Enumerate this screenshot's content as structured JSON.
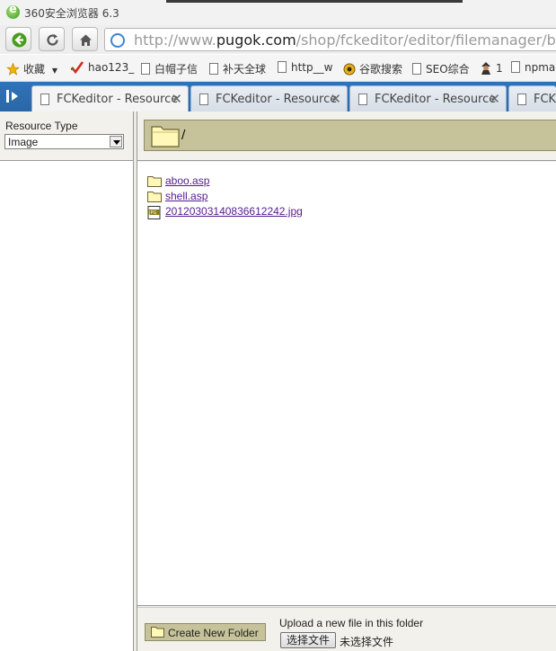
{
  "browser": {
    "title": "360安全浏览器 6.3",
    "url_prefix": "http://www.",
    "url_host": "pugok.com",
    "url_path": "/shop/fckeditor/editor/filemanager/brov",
    "accent": "#2f73b9"
  },
  "bookmarks": [
    {
      "label": "收藏",
      "icon": "star-icon"
    },
    {
      "label": "hao123_",
      "icon": "hao123-icon"
    },
    {
      "label": "白帽子信",
      "icon": "page-icon"
    },
    {
      "label": "补天全球",
      "icon": "page-icon"
    },
    {
      "label": "http__w",
      "icon": "page-icon"
    },
    {
      "label": "谷歌搜索",
      "icon": "google-icon"
    },
    {
      "label": "SEO综合",
      "icon": "page-icon"
    },
    {
      "label": "1",
      "icon": "spy-icon"
    },
    {
      "label": "npma",
      "icon": "page-icon"
    }
  ],
  "tabs": [
    {
      "label": "FCKeditor - Resource",
      "active": true
    },
    {
      "label": "FCKeditor - Resource",
      "active": false
    },
    {
      "label": "FCKeditor - Resource",
      "active": false
    },
    {
      "label": "FCKe",
      "active": false
    }
  ],
  "resource_panel": {
    "label": "Resource Type",
    "selected": "Image"
  },
  "folder": {
    "path": "/"
  },
  "files": [
    {
      "name": "aboo.asp",
      "type": "folder"
    },
    {
      "name": "shell.asp",
      "type": "folder"
    },
    {
      "name": "20120303140836612242.jpg",
      "type": "jpg"
    }
  ],
  "bottom": {
    "new_folder_label": "Create New Folder",
    "upload_label": "Upload a new file in this folder",
    "choose_button": "选择文件",
    "no_file": "未选择文件"
  }
}
